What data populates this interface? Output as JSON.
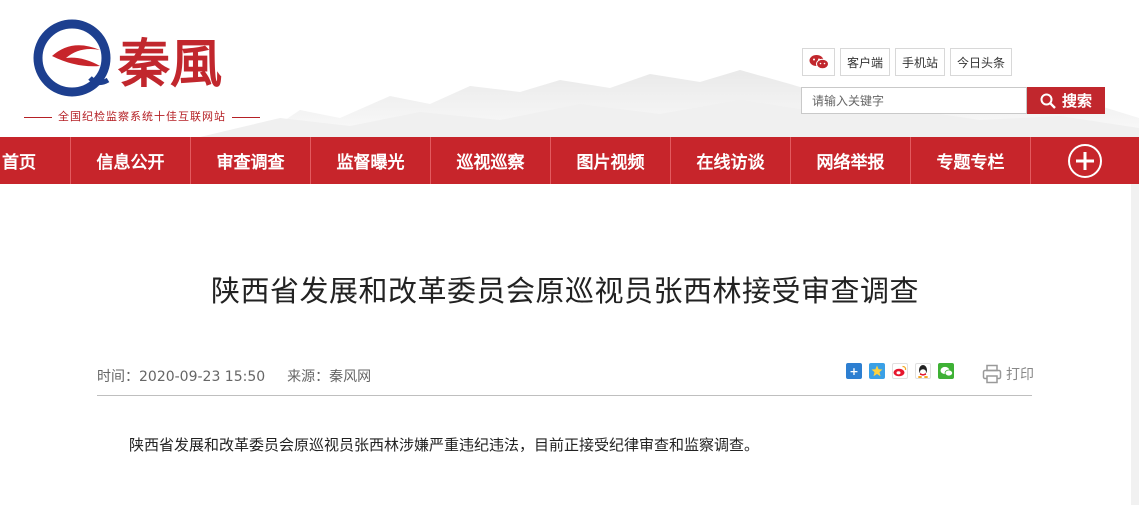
{
  "header": {
    "logo_text": "秦風",
    "tagline": "全国纪检监察系统十佳互联网站",
    "top_links": [
      "客户端",
      "手机站",
      "今日头条"
    ],
    "search": {
      "placeholder": "请输入关键字",
      "button_label": "搜索"
    }
  },
  "nav": {
    "items": [
      "首页",
      "信息公开",
      "审查调查",
      "监督曝光",
      "巡视巡察",
      "图片视频",
      "在线访谈",
      "网络举报",
      "专题专栏"
    ]
  },
  "article": {
    "title": "陕西省发展和改革委员会原巡视员张西林接受审查调查",
    "time": "时间：2020-09-23 15:50",
    "source": "来源：秦风网",
    "print_label": "打印",
    "body": "陕西省发展和改革委员会原巡视员张西林涉嫌严重违纪违法，目前正接受纪律审查和监察调查。"
  },
  "colors": {
    "brand_red": "#c7252b",
    "logo_blue": "#1d3f8f"
  }
}
